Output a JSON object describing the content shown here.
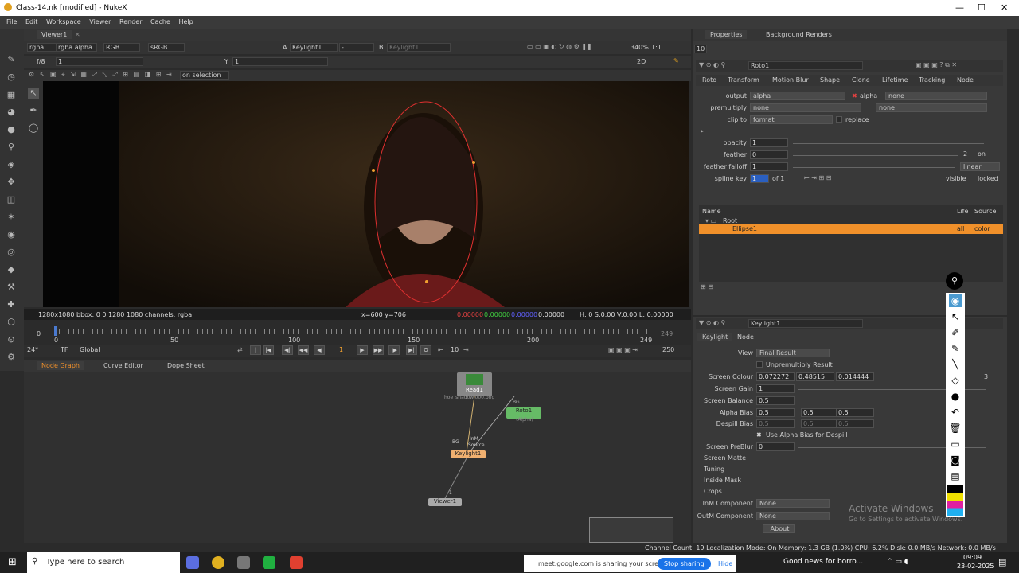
{
  "window": {
    "title": "Class-14.nk [modified] - NukeX"
  },
  "menu": [
    "File",
    "Edit",
    "Workspace",
    "Viewer",
    "Render",
    "Cache",
    "Help"
  ],
  "viewer": {
    "tab": "Viewer1",
    "channels": "rgba",
    "alpha": "rgba.alpha",
    "colorspace_in": "RGB",
    "display": "sRGB",
    "input_a_label": "A",
    "input_a": "Keylight1",
    "input_a2": "-",
    "input_b_label": "B",
    "input_b": "Keylight1",
    "zoom": "340%",
    "ratio": "1:1",
    "mode": "2D",
    "fstop": "f/8",
    "frame_x": "1",
    "y_label": "Y",
    "y_value": "1",
    "on_selection": "on selection",
    "info_left": "1280x1080  bbox: 0 0 1280 1080 channels: rgba",
    "info_xy": "x=600 y=706",
    "info_r": "0.00000",
    "info_g": "0.00000",
    "info_b": "0.00000",
    "info_a": "0.00000",
    "info_hsv": "H: 0 S:0.00 V:0.00  L: 0.00000"
  },
  "timeline": {
    "ticks": [
      "0",
      "50",
      "100",
      "150",
      "200",
      "249"
    ],
    "left_value": "0",
    "right_value": "249",
    "fps": "24*",
    "tf": "TF",
    "global": "Global",
    "current_frame": "1",
    "step": "10",
    "end_frame": "250"
  },
  "nodegraph_tabs": [
    "Node Graph",
    "Curve Editor",
    "Dope Sheet"
  ],
  "nodes": {
    "read": "Read1",
    "read_file": "hoe_shadow.000.png",
    "roto": "Roto1",
    "roto_sub": "(Alpha)",
    "keylight": "Keylight1",
    "keylight_inputs": "Source",
    "keylight_bg": "BG",
    "keylight_inm": "InM",
    "roto_bg": "BG",
    "viewer": "Viewer1",
    "viewer_input": "1"
  },
  "properties": {
    "tabs": [
      "Properties",
      "Background Renders"
    ],
    "count": "10",
    "roto_name": "Roto1",
    "roto_tabs": [
      "Roto",
      "Transform",
      "Motion Blur",
      "Shape",
      "Clone",
      "Lifetime",
      "Tracking",
      "Node"
    ],
    "output_label": "output",
    "output": "alpha",
    "output_ch": "alpha",
    "output_none": "none",
    "premult_label": "premultiply",
    "premult": "none",
    "premult_none": "none",
    "clip_label": "clip to",
    "clip": "format",
    "replace": "replace",
    "opacity_label": "opacity",
    "opacity": "1",
    "feather_label": "feather",
    "feather": "0",
    "feather_count": "2",
    "feather_on": "on",
    "falloff_label": "feather falloff",
    "falloff": "1",
    "falloff_type": "linear",
    "spline_label": "spline key",
    "spline_key": "1",
    "spline_of": "of 1",
    "visible": "visible",
    "locked": "locked",
    "layer_headers": [
      "Name",
      "Life",
      "Source"
    ],
    "root": "Root",
    "ellipse": "Ellipse1",
    "ellipse_life": "all",
    "ellipse_source": "color"
  },
  "keylight": {
    "name": "Keylight1",
    "tabs": [
      "Keylight",
      "Node"
    ],
    "view_label": "View",
    "view": "Final Result",
    "unpremult": "Unpremultiply Result",
    "screen_colour_label": "Screen Colour",
    "screen_colour": [
      "0.072272",
      "0.48515",
      "0.014444"
    ],
    "screen_gain_label": "Screen Gain",
    "screen_gain": "1",
    "screen_balance_label": "Screen Balance",
    "screen_balance": "0.5",
    "alpha_bias_label": "Alpha Bias",
    "alpha_bias": [
      "0.5",
      "0.5",
      "0.5"
    ],
    "despill_label": "Despill Bias",
    "despill": [
      "0.5",
      "0.5",
      "0.5"
    ],
    "use_alpha": "Use Alpha Bias for Despill",
    "preblur_label": "Screen PreBlur",
    "preblur": "0",
    "sections": [
      "Screen Matte",
      "Tuning",
      "Inside Mask",
      "Crops"
    ],
    "inm_label": "InM Component",
    "inm": "None",
    "outm_label": "OutM Component",
    "outm": "None",
    "about": "About",
    "count3": "3"
  },
  "watermark": {
    "title": "Activate Windows",
    "sub": "Go to Settings to activate Windows."
  },
  "status": "Channel Count: 19  Localization Mode: On  Memory: 1.3 GB (1.0%)  CPU: 6.2%  Disk: 0.0 MB/s  Network: 0.0 MB/s",
  "taskbar": {
    "search": "Type here to search",
    "share_text": "meet.google.com is sharing your screen.",
    "stop": "Stop sharing",
    "hide": "Hide",
    "news": "Good news for borro...",
    "time": "09:09",
    "date": "23-02-2025"
  },
  "colors": {
    "accent": "#f0902a",
    "roto_node": "#66bb66",
    "keylight_node": "#f0b070"
  }
}
